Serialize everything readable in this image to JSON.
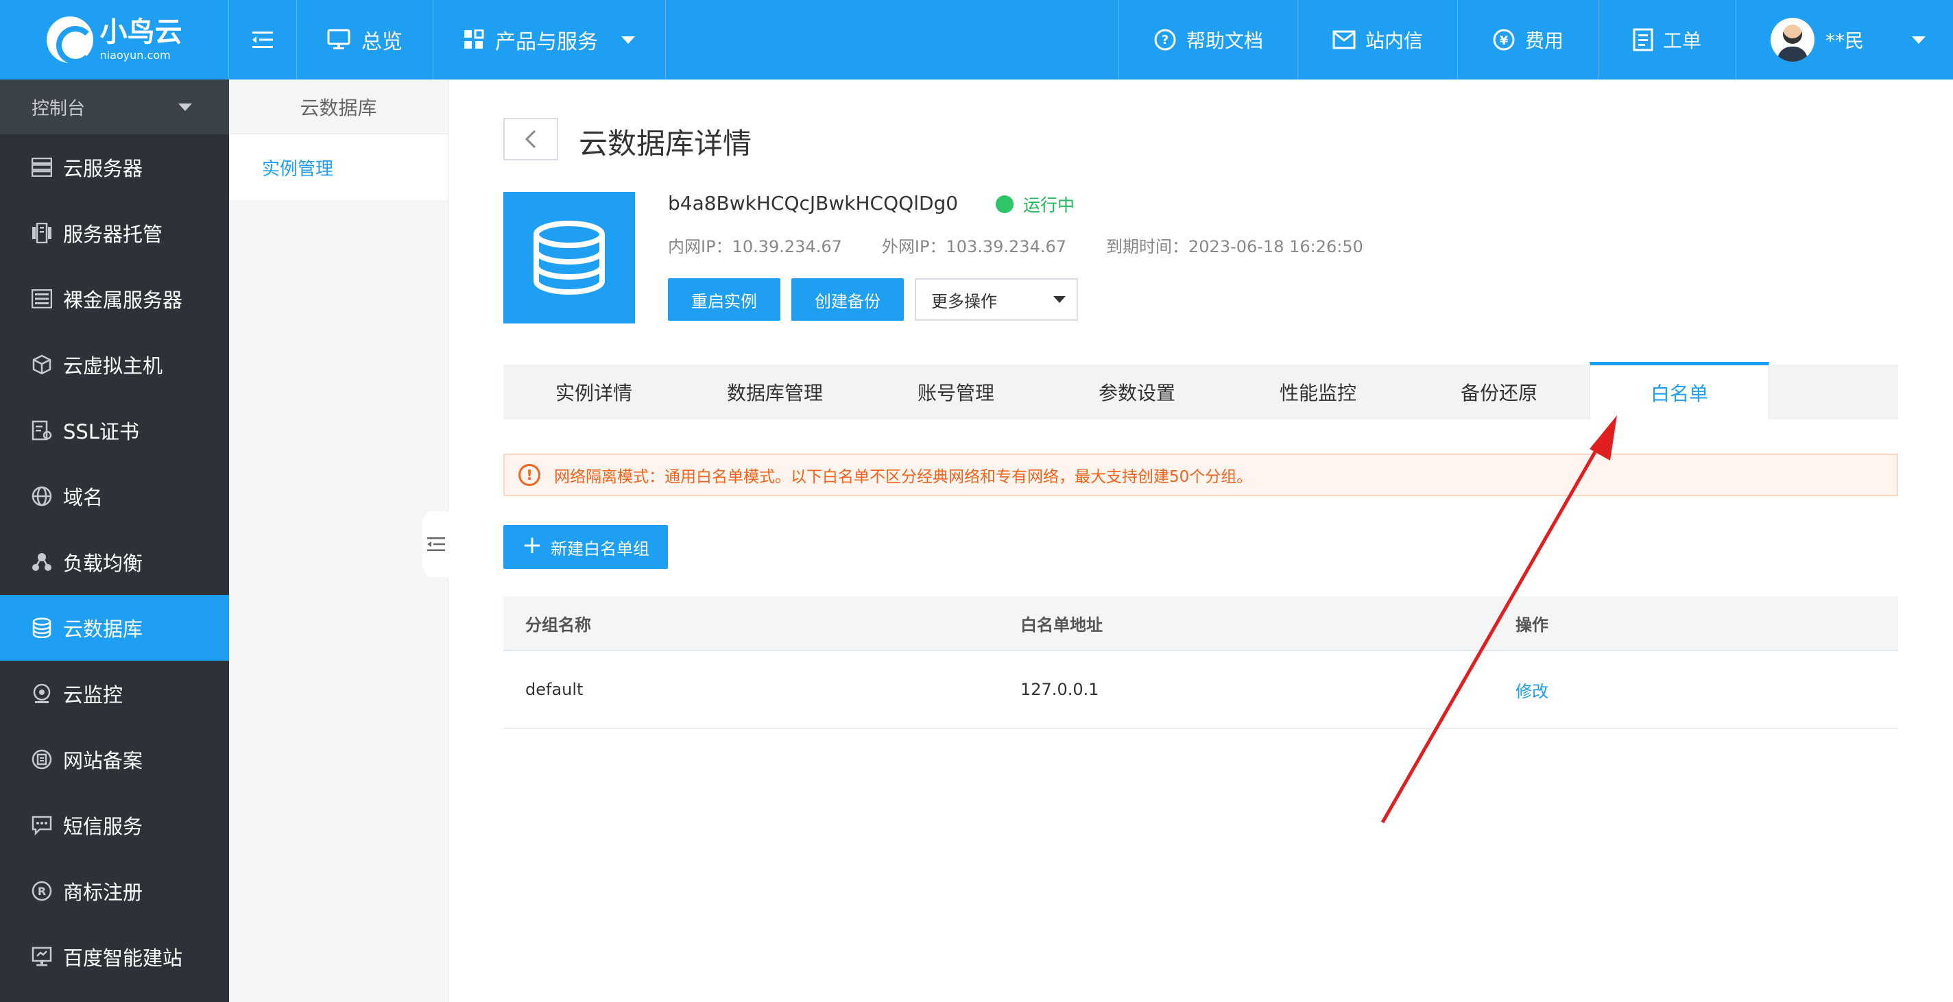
{
  "topbar": {
    "logo_cn": "小鸟云",
    "logo_en": "niaoyun.com",
    "overview": "总览",
    "products": "产品与服务",
    "help_docs": "帮助文档",
    "messages": "站内信",
    "fees": "费用",
    "tickets": "工单",
    "user_name": "**民"
  },
  "sidebar": {
    "header": "控制台",
    "items": [
      {
        "label": "云服务器",
        "icon": "server-stack-icon"
      },
      {
        "label": "服务器托管",
        "icon": "server-rack-icon"
      },
      {
        "label": "裸金属服务器",
        "icon": "bare-metal-icon"
      },
      {
        "label": "云虚拟主机",
        "icon": "cube-icon"
      },
      {
        "label": "SSL证书",
        "icon": "certificate-icon"
      },
      {
        "label": "域名",
        "icon": "globe-icon"
      },
      {
        "label": "负载均衡",
        "icon": "load-balance-icon"
      },
      {
        "label": "云数据库",
        "icon": "database-icon"
      },
      {
        "label": "云监控",
        "icon": "monitor-icon"
      },
      {
        "label": "网站备案",
        "icon": "record-icon"
      },
      {
        "label": "短信服务",
        "icon": "sms-icon"
      },
      {
        "label": "商标注册",
        "icon": "trademark-icon"
      },
      {
        "label": "百度智能建站",
        "icon": "site-builder-icon"
      }
    ],
    "active_index": 7
  },
  "subnav": {
    "title": "云数据库",
    "item": "实例管理"
  },
  "main": {
    "page_title": "云数据库详情",
    "instance_id": "b4a8BwkHCQcJBwkHCQQlDg0",
    "status": "运行中",
    "inner_ip": "内网IP：10.39.234.67",
    "outer_ip": "外网IP：103.39.234.67",
    "expire": "到期时间：2023-06-18 16:26:50",
    "btn_restart": "重启实例",
    "btn_backup": "创建备份",
    "more_ops": "更多操作",
    "tabs": [
      "实例详情",
      "数据库管理",
      "账号管理",
      "参数设置",
      "性能监控",
      "备份还原",
      "白名单"
    ],
    "active_tab": 6,
    "alert": "网络隔离模式：通用白名单模式。以下白名单不区分经典网络和专有网络，最大支持创建50个分组。",
    "btn_new_group": "新建白名单组",
    "table": {
      "headers": [
        "分组名称",
        "白名单地址",
        "操作"
      ],
      "rows": [
        {
          "name": "default",
          "address": "127.0.0.1",
          "action": "修改"
        }
      ]
    }
  },
  "colors": {
    "brand_blue": "#1e9ff2",
    "sidebar_dark": "#2c3238",
    "status_green": "#2ec468",
    "alert_orange": "#f0641e",
    "annotation_arrow": "#e02020"
  }
}
